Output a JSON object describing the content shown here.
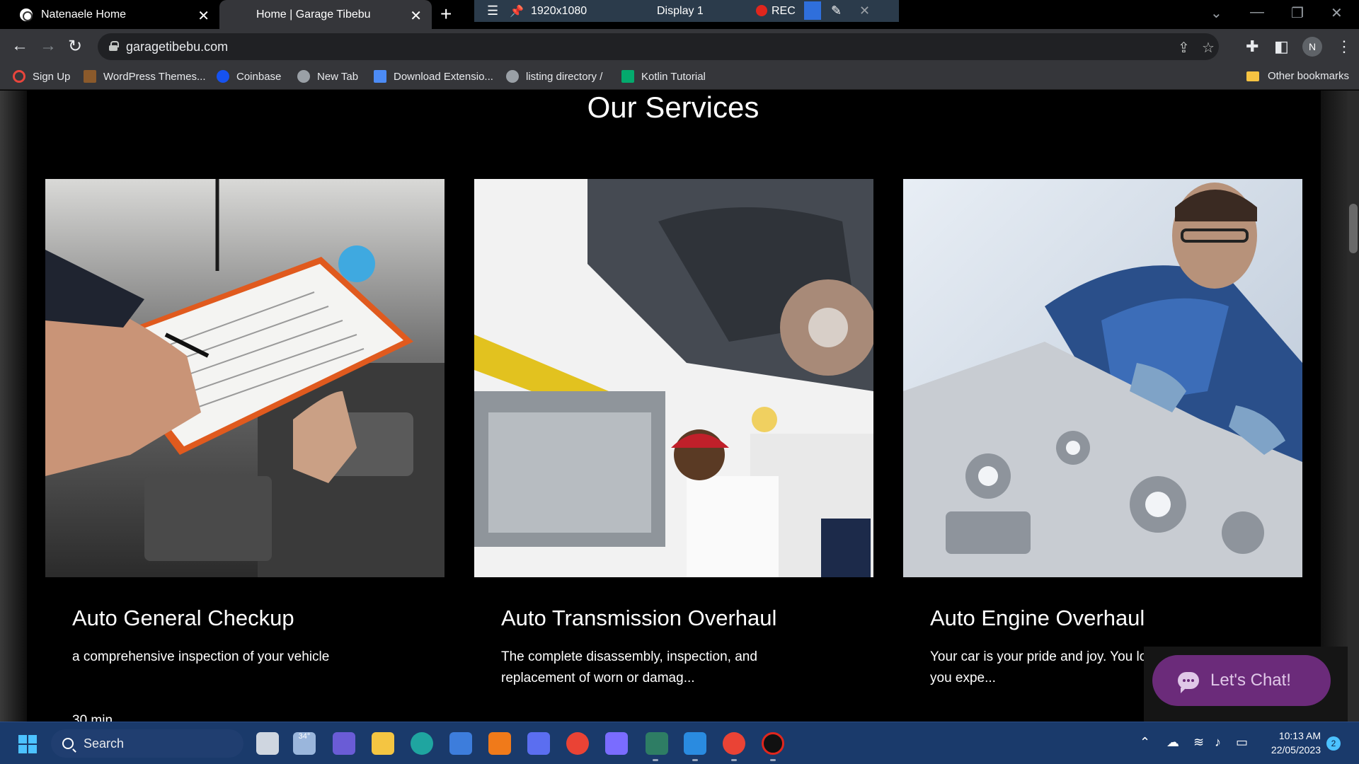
{
  "browser": {
    "tabs": [
      {
        "title": "Natenaele Home",
        "active": false
      },
      {
        "title": "Home | Garage Tibebu",
        "active": true
      }
    ],
    "url": "garagetibebu.com",
    "profile_initial": "N"
  },
  "recorder": {
    "resolution": "1920x1080",
    "display": "Display 1",
    "rec_label": "REC"
  },
  "bookmarks": {
    "items": [
      {
        "label": "Sign Up",
        "color": "#e8453c"
      },
      {
        "label": "WordPress Themes...",
        "color": "#8b5a2b"
      },
      {
        "label": "Coinbase",
        "color": "#1652f0"
      },
      {
        "label": "New Tab",
        "color": "#9aa0a6"
      },
      {
        "label": "Download Extensio...",
        "color": "#4c8bf5"
      },
      {
        "label": "listing directory /",
        "color": "#9aa0a6"
      },
      {
        "label": "Kotlin Tutorial",
        "color": "#04aa6d"
      }
    ],
    "other": "Other bookmarks"
  },
  "page": {
    "section_title": "Our Services",
    "services": [
      {
        "title": "Auto General Checkup",
        "description": "a comprehensive inspection of your vehicle"
      },
      {
        "title": "Auto Transmission Overhaul",
        "description": "The complete disassembly, inspection, and replacement of worn or damag..."
      },
      {
        "title": "Auto Engine Overhaul",
        "description": "Your car is your pride and joy. You love it, and you expe..."
      }
    ],
    "meta_first": "30 min",
    "chat_label": "Let's Chat!"
  },
  "taskbar": {
    "search_label": "Search",
    "weather": "34°",
    "time": "10:13 AM",
    "date": "22/05/2023",
    "notification_count": "2"
  }
}
